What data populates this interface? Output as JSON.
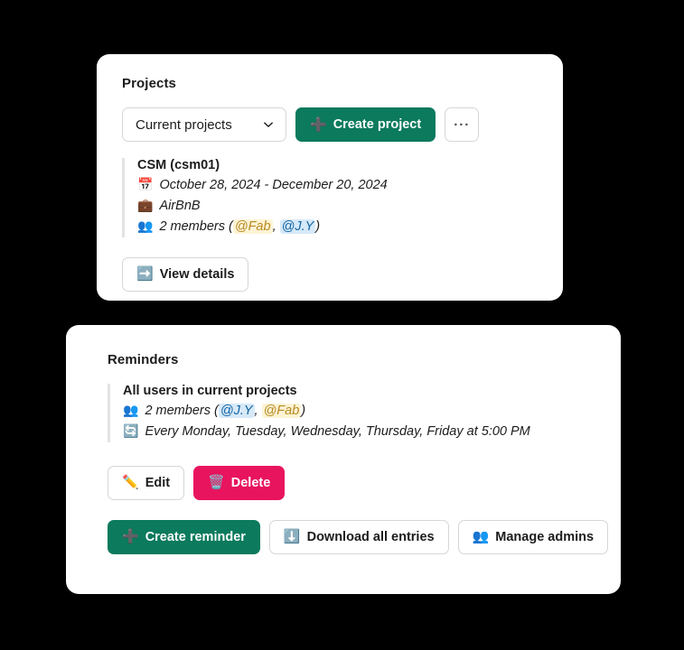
{
  "theme": {
    "page_background": "#000000",
    "card_background": "#ffffff",
    "primary_green": "#0b7a5d",
    "danger_pink": "#e8145e",
    "mention_blue_bg": "#d6e9f8",
    "mention_blue_text": "#1264a3",
    "mention_yellow_bg": "#fdf3d4",
    "mention_yellow_text": "#b88a23"
  },
  "projects_card": {
    "title": "Projects",
    "filter_select": {
      "value": "Current projects",
      "chevron_icon": "chevron-down-icon"
    },
    "create_button": {
      "icon": "plus-icon",
      "icon_glyph": "➕",
      "label": "Create project"
    },
    "overflow_button": {
      "label": "···",
      "icon": "ellipsis-icon"
    },
    "project": {
      "name": "CSM (csm01)",
      "date_icon": "calendar-icon",
      "date_glyph": "📅",
      "dates": "October 28, 2024 - December 20, 2024",
      "client_icon": "briefcase-icon",
      "client_glyph": "💼",
      "client": "AirBnB",
      "members_icon": "people-icon",
      "members_glyph": "👥",
      "members_count_text": "2 members",
      "members_open_paren": "(",
      "members": [
        {
          "handle": "@Fab",
          "style": "yellow"
        },
        {
          "handle": "@J.Y",
          "style": "blue"
        }
      ],
      "members_separator": ",",
      "members_close_paren": ")"
    },
    "view_details_button": {
      "icon": "right-arrow-icon",
      "icon_glyph": "➡️",
      "label": "View details"
    }
  },
  "reminders_card": {
    "title": "Reminders",
    "reminder": {
      "heading": "All users in current projects",
      "members_icon": "people-icon",
      "members_glyph": "👥",
      "members_count_text": "2 members",
      "members_open_paren": "(",
      "members": [
        {
          "handle": "@J.Y",
          "style": "blue"
        },
        {
          "handle": "@Fab",
          "style": "yellow"
        }
      ],
      "members_separator": ",",
      "members_close_paren": ")",
      "schedule_icon": "repeat-icon",
      "schedule_glyph": "🔄",
      "schedule": "Every Monday, Tuesday, Wednesday, Thursday, Friday at 5:00 PM"
    },
    "edit_button": {
      "icon": "pencil-icon",
      "icon_glyph": "✏️",
      "label": "Edit"
    },
    "delete_button": {
      "icon": "trash-icon",
      "icon_glyph": "🗑️",
      "label": "Delete"
    },
    "create_reminder_button": {
      "icon": "plus-icon",
      "icon_glyph": "➕",
      "label": "Create reminder"
    },
    "download_button": {
      "icon": "download-arrow-icon",
      "icon_glyph": "⬇️",
      "label": "Download all entries"
    },
    "manage_admins_button": {
      "icon": "people-icon",
      "icon_glyph": "👥",
      "label": "Manage admins"
    }
  }
}
